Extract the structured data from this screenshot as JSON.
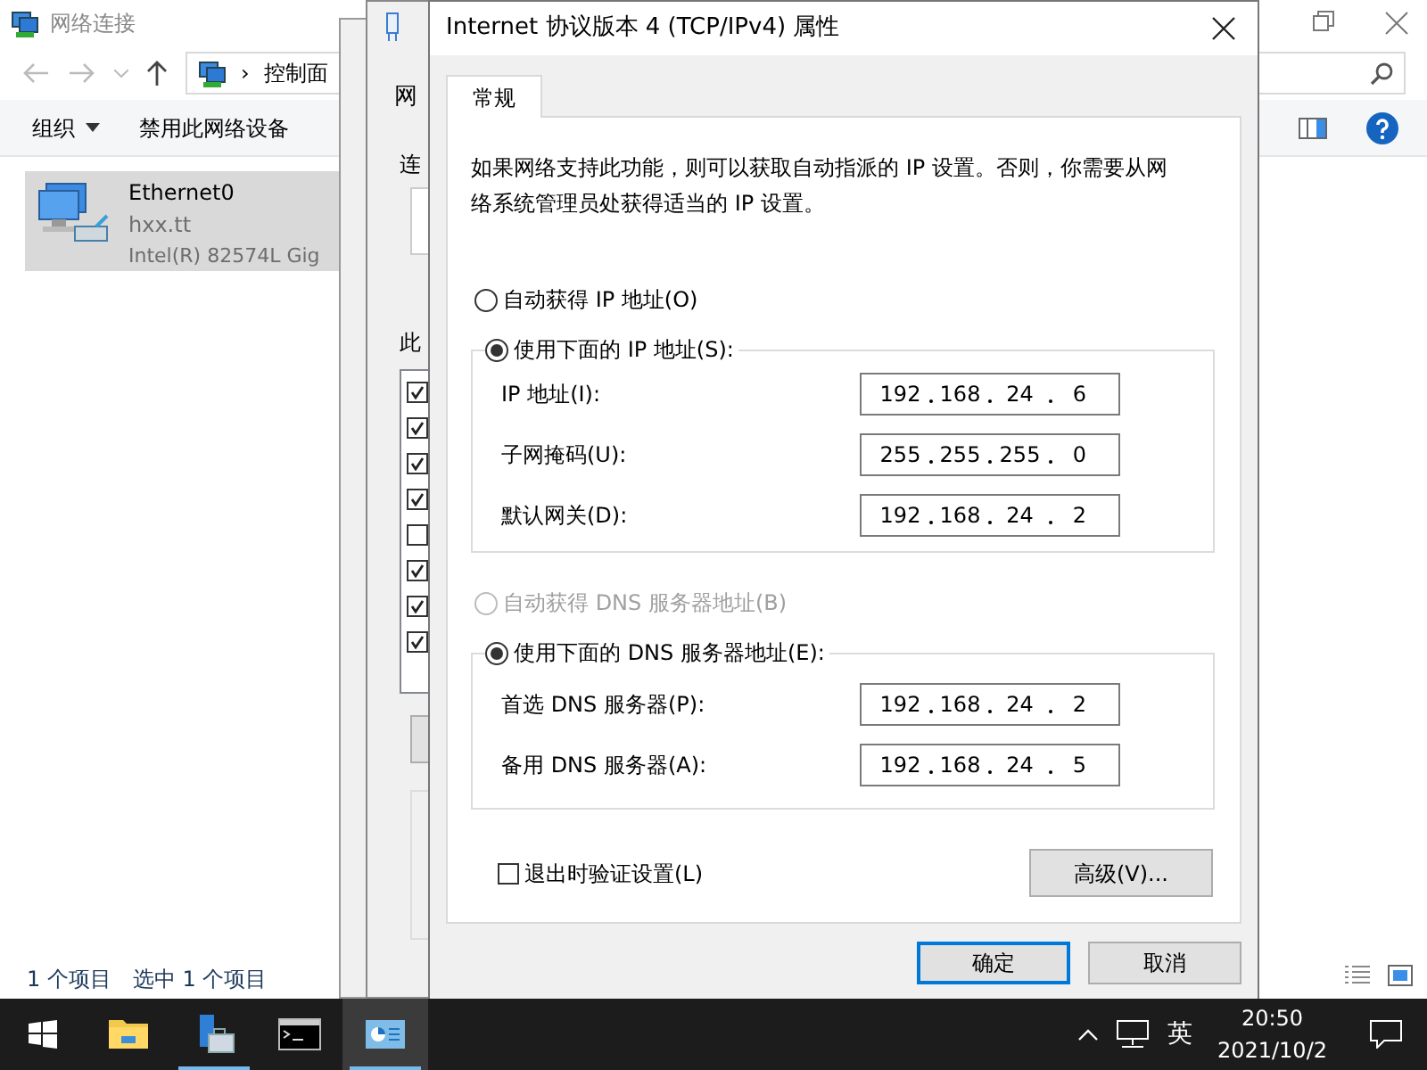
{
  "explorer": {
    "title": "网络连接",
    "breadcrumb_separator": "›",
    "address": "控制面",
    "toolbar": [
      "组织",
      "禁用此网络设备"
    ],
    "item": {
      "name": "Ethernet0",
      "network": "hxx.tt",
      "device": "Intel(R) 82574L Gig",
      "selected": true
    },
    "status": [
      "1 个项目",
      "选中 1 个项目"
    ]
  },
  "properties_window": {
    "tab": "网",
    "label_1": "连",
    "label_2": "此",
    "components": [
      {
        "checked": true
      },
      {
        "checked": true
      },
      {
        "checked": true
      },
      {
        "checked": true
      },
      {
        "checked": false
      },
      {
        "checked": true
      },
      {
        "checked": true
      },
      {
        "checked": true
      }
    ]
  },
  "dialog": {
    "title": "Internet 协议版本 4 (TCP/IPv4) 属性",
    "tabs": [
      {
        "label": "常规",
        "selected": true
      }
    ],
    "description": "如果网络支持此功能，则可以获取自动指派的 IP 设置。否则，你需要从网络系统管理员处获得适当的 IP 设置。",
    "ip_mode": [
      {
        "label": "自动获得 IP 地址(O)",
        "selected": false,
        "disabled": false
      },
      {
        "label": "使用下面的 IP 地址(S):",
        "selected": true,
        "disabled": false
      }
    ],
    "ip_fields": [
      {
        "label": "IP 地址(I):",
        "octets": [
          "192",
          "168",
          "24",
          "6"
        ]
      },
      {
        "label": "子网掩码(U):",
        "octets": [
          "255",
          "255",
          "255",
          "0"
        ]
      },
      {
        "label": "默认网关(D):",
        "octets": [
          "192",
          "168",
          "24",
          "2"
        ]
      }
    ],
    "dns_mode": [
      {
        "label": "自动获得 DNS 服务器地址(B)",
        "selected": false,
        "disabled": true
      },
      {
        "label": "使用下面的 DNS 服务器地址(E):",
        "selected": true,
        "disabled": false
      }
    ],
    "dns_fields": [
      {
        "label": "首选 DNS 服务器(P):",
        "octets": [
          "192",
          "168",
          "24",
          "2"
        ]
      },
      {
        "label": "备用 DNS 服务器(A):",
        "octets": [
          "192",
          "168",
          "24",
          "5"
        ]
      }
    ],
    "validate": {
      "label": "退出时验证设置(L)",
      "checked": false
    },
    "advanced": "高级(V)...",
    "buttons": [
      "确定",
      "取消"
    ]
  },
  "taskbar": {
    "apps": [
      {
        "kind": "folder",
        "running": false,
        "active": false
      },
      {
        "kind": "server",
        "running": true,
        "active": false
      },
      {
        "kind": "console",
        "running": false,
        "active": false
      },
      {
        "kind": "network",
        "running": true,
        "active": true
      }
    ],
    "language": "英",
    "time": "20:50",
    "date": "2021/10/2"
  }
}
